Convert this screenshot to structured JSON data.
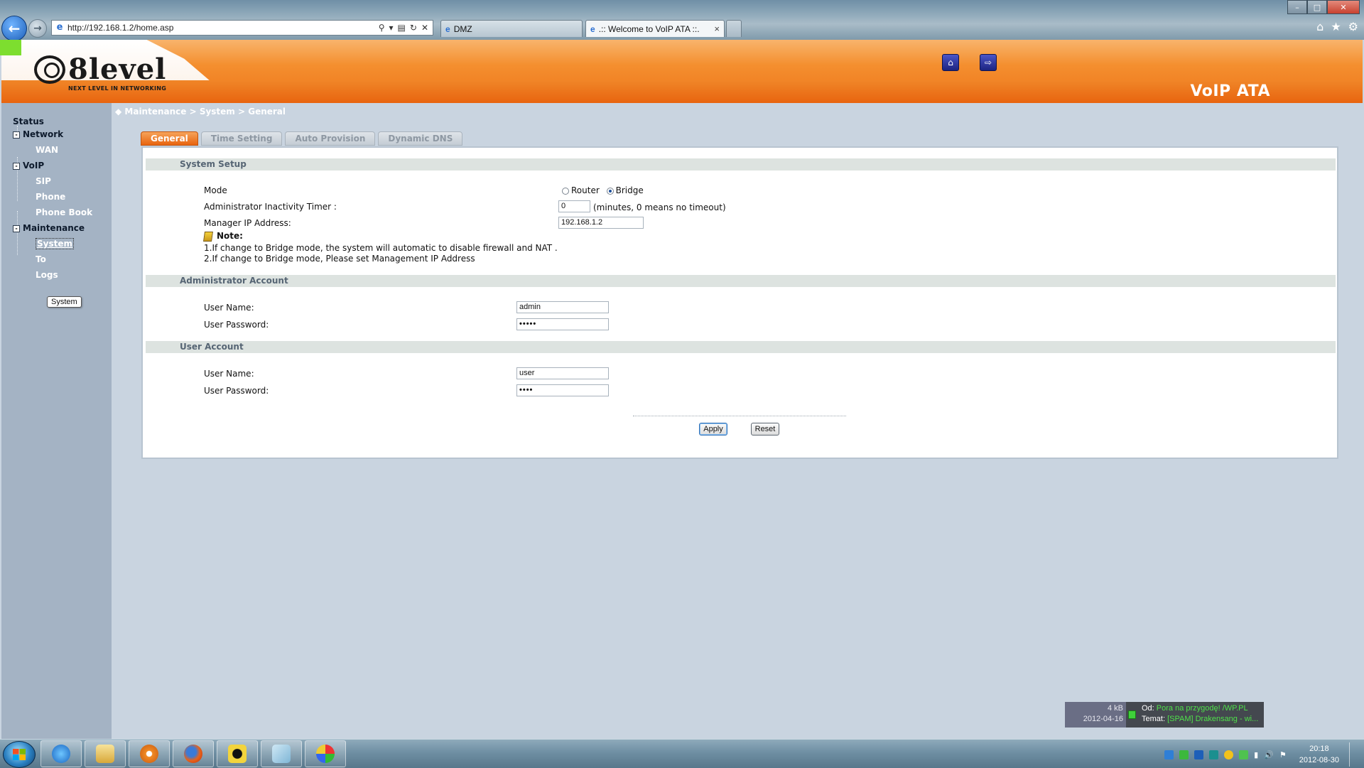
{
  "browser": {
    "address_url": "http://192.168.1.2/home.asp",
    "tabs": [
      {
        "label": "DMZ"
      },
      {
        "label": ".:: Welcome to VoIP ATA ::.",
        "active": true
      }
    ],
    "tab_close_glyph": "×"
  },
  "header": {
    "logo_text": "8level",
    "logo_tagline": "NEXT LEVEL IN NETWORKING",
    "product_title": "VoIP ATA",
    "icons": [
      "home-icon",
      "logout-icon"
    ],
    "accent_color": "#ee7419"
  },
  "breadcrumb": "◆  Maintenance > System > General",
  "sidebar": {
    "status": "Status",
    "network": "Network",
    "wan": "WAN",
    "voip": "VoIP",
    "sip": "SIP",
    "phone": "Phone",
    "phone_book": "Phone Book",
    "maintenance": "Maintenance",
    "system": "System",
    "tools_partial": "To",
    "logs": "Logs",
    "tooltip": "System"
  },
  "tabs": [
    {
      "label": "General",
      "active": true
    },
    {
      "label": "Time Setting",
      "active": false
    },
    {
      "label": "Auto Provision",
      "active": false
    },
    {
      "label": "Dynamic DNS",
      "active": false
    }
  ],
  "system_setup": {
    "header": "System Setup",
    "mode_label": "Mode",
    "mode_options": [
      "Router",
      "Bridge"
    ],
    "mode_selected": "Bridge",
    "timer_label": "Administrator Inactivity Timer :",
    "timer_value": "0",
    "timer_hint": "(minutes, 0 means no timeout)",
    "manager_ip_label": "Manager IP Address:",
    "manager_ip_value": "192.168.1.2",
    "note_title": "Note:",
    "note_1": "1.If change to Bridge mode, the system will automatic to disable firewall and NAT .",
    "note_2": "2.If change to Bridge mode, Please set Management IP Address"
  },
  "admin_account": {
    "header": "Administrator Account",
    "username_label": "User Name:",
    "username_value": "admin",
    "password_label": "User Password:",
    "password_value": "•••••"
  },
  "user_account": {
    "header": "User Account",
    "username_label": "User Name:",
    "username_value": "user",
    "password_label": "User Password:",
    "password_value": "••••"
  },
  "buttons": {
    "apply": "Apply",
    "reset": "Reset"
  },
  "mail_notification": {
    "size": "4 kB",
    "date": "2012-04-16",
    "from_label": "Od:",
    "from_value": "Pora na przygodę! /WP.PL",
    "subject_label": "Temat:",
    "subject_value": "[SPAM] Drakensang - wi..."
  },
  "taskbar": {
    "pinned": [
      "internet-explorer-icon",
      "explorer-folder-icon",
      "media-player-icon",
      "firefox-icon",
      "batman-app-icon",
      "notepad-icon",
      "paint-icon"
    ],
    "clock_time": "20:18",
    "clock_date": "2012-08-30"
  }
}
